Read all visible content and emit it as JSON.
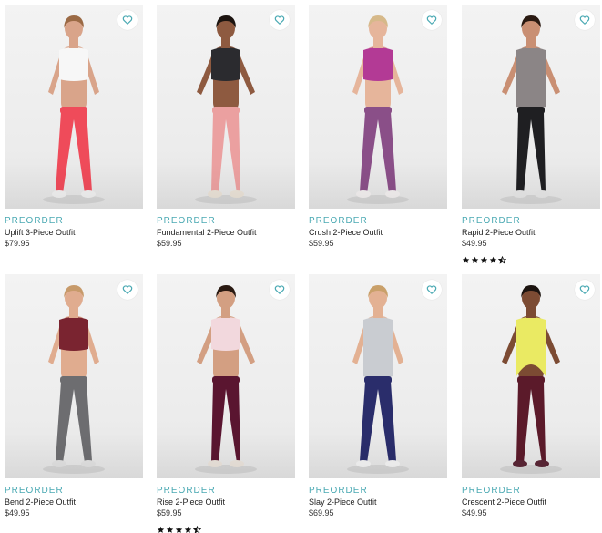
{
  "accent_color": "#4aa9b3",
  "products": [
    {
      "badge": "PREORDER",
      "name": "Uplift 3-Piece Outfit",
      "price": "$79.95",
      "favorite_icon": "heart-outline-icon",
      "rating": null,
      "colors": {
        "top": "#f7f7f7",
        "bottom": "#ef4b5a",
        "skin": "#d9a48a",
        "hair": "#9b6a45",
        "shoe": "#efefef"
      }
    },
    {
      "badge": "PREORDER",
      "name": "Fundamental 2-Piece Outfit",
      "price": "$59.95",
      "favorite_icon": "heart-outline-icon",
      "rating": null,
      "colors": {
        "top": "#2b2b2f",
        "bottom": "#eba0a0",
        "skin": "#8e5a40",
        "hair": "#1c1410",
        "shoe": "#e9e1d6"
      }
    },
    {
      "badge": "PREORDER",
      "name": "Crush 2-Piece Outfit",
      "price": "$59.95",
      "favorite_icon": "heart-outline-icon",
      "rating": null,
      "colors": {
        "top": "#b33a95",
        "bottom": "#8a4f88",
        "skin": "#e6b59b",
        "hair": "#d6b98a",
        "shoe": "#f1eeee"
      }
    },
    {
      "badge": "PREORDER",
      "name": "Rapid 2-Piece Outfit",
      "price": "$49.95",
      "favorite_icon": "heart-outline-icon",
      "rating": 4.5,
      "colors": {
        "top": "#8b8586",
        "bottom": "#1f1f22",
        "skin": "#c98f73",
        "hair": "#2a1a12",
        "shoe": "#e5e5e5"
      }
    },
    {
      "badge": "PREORDER",
      "name": "Bend 2-Piece Outfit",
      "price": "$49.95",
      "favorite_icon": "heart-outline-icon",
      "rating": null,
      "colors": {
        "top": "#7a2430",
        "bottom": "#6d6d70",
        "skin": "#e0ac8f",
        "hair": "#c79a6a",
        "shoe": "#e0e0e0"
      }
    },
    {
      "badge": "PREORDER",
      "name": "Rise 2-Piece Outfit",
      "price": "$59.95",
      "favorite_icon": "heart-outline-icon",
      "rating": 4.5,
      "colors": {
        "top": "#f2d8dd",
        "bottom": "#5a1530",
        "skin": "#d39f82",
        "hair": "#2a1a12",
        "shoe": "#e9e2da"
      }
    },
    {
      "badge": "PREORDER",
      "name": "Slay 2-Piece Outfit",
      "price": "$69.95",
      "favorite_icon": "heart-outline-icon",
      "rating": null,
      "colors": {
        "top": "#c9ccd1",
        "bottom": "#2a2d6b",
        "skin": "#e3b193",
        "hair": "#c9a06a",
        "shoe": "#f2f2f2"
      }
    },
    {
      "badge": "PREORDER",
      "name": "Crescent 2-Piece Outfit",
      "price": "$49.95",
      "favorite_icon": "heart-outline-icon",
      "rating": null,
      "colors": {
        "top": "#eaea63",
        "bottom": "#5b1a2a",
        "skin": "#7c4b33",
        "hair": "#1c1410",
        "shoe": "#5a2636"
      }
    }
  ]
}
